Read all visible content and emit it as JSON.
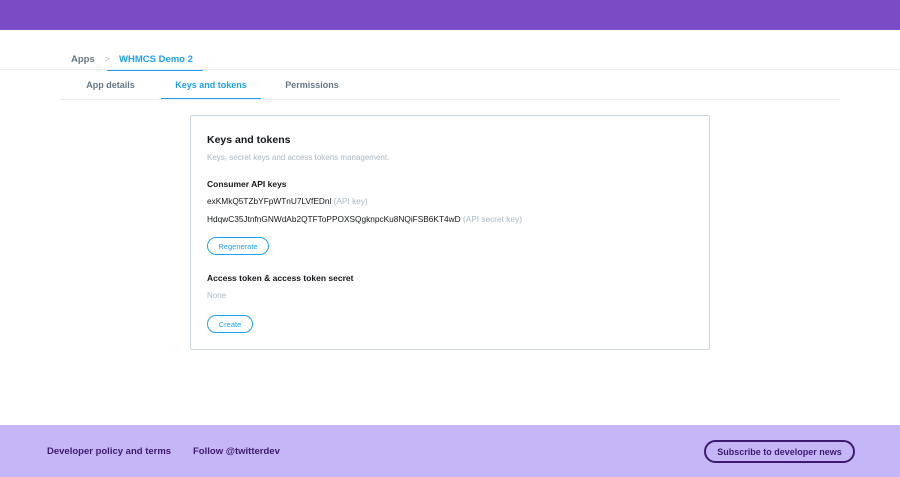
{
  "header": {
    "bar_color": "#794bc4"
  },
  "breadcrumb": {
    "root": "Apps",
    "separator": ">",
    "current": "WHMCS Demo 2"
  },
  "tabs": [
    {
      "label": "App details",
      "active": false
    },
    {
      "label": "Keys and tokens",
      "active": true
    },
    {
      "label": "Permissions",
      "active": false
    }
  ],
  "card": {
    "title": "Keys and tokens",
    "subtitle": "Keys, secret keys and access tokens management.",
    "consumer": {
      "heading": "Consumer API keys",
      "api_key": "exKMkQ5TZbYFpWTnU7LVfEDnl",
      "api_key_hint": "(API key)",
      "api_secret": "HdqwC35JtnfnGNWdAb2QTFToPPOXSQgknpcKu8NQiFSB6KT4wD",
      "api_secret_hint": "(API secret key)",
      "regenerate_label": "Regenerate"
    },
    "access": {
      "heading": "Access token & access token secret",
      "value": "None",
      "create_label": "Create"
    }
  },
  "footer": {
    "background": "#c5b6f7",
    "policy_link": "Developer policy and terms",
    "follow_link": "Follow @twitterdev",
    "subscribe_label": "Subscribe to developer news"
  },
  "colors": {
    "accent": "#1da1f2",
    "footer_text": "#3d1b72"
  }
}
